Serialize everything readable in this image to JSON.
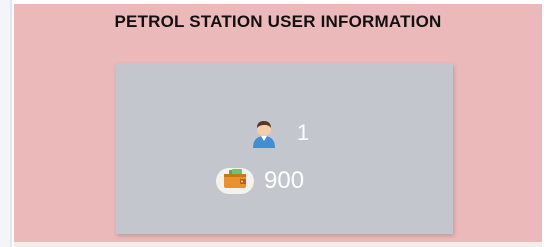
{
  "page": {
    "title": "PETROL STATION USER INFORMATION"
  },
  "stats": {
    "users": {
      "icon": "user-avatar-icon",
      "value": "1"
    },
    "wallet": {
      "icon": "wallet-icon",
      "value": "900"
    }
  },
  "colors": {
    "panel_background": "#ecb9bb",
    "card_background": "#c4c6cd",
    "title_text": "#111111",
    "value_text": "#ffffff"
  }
}
